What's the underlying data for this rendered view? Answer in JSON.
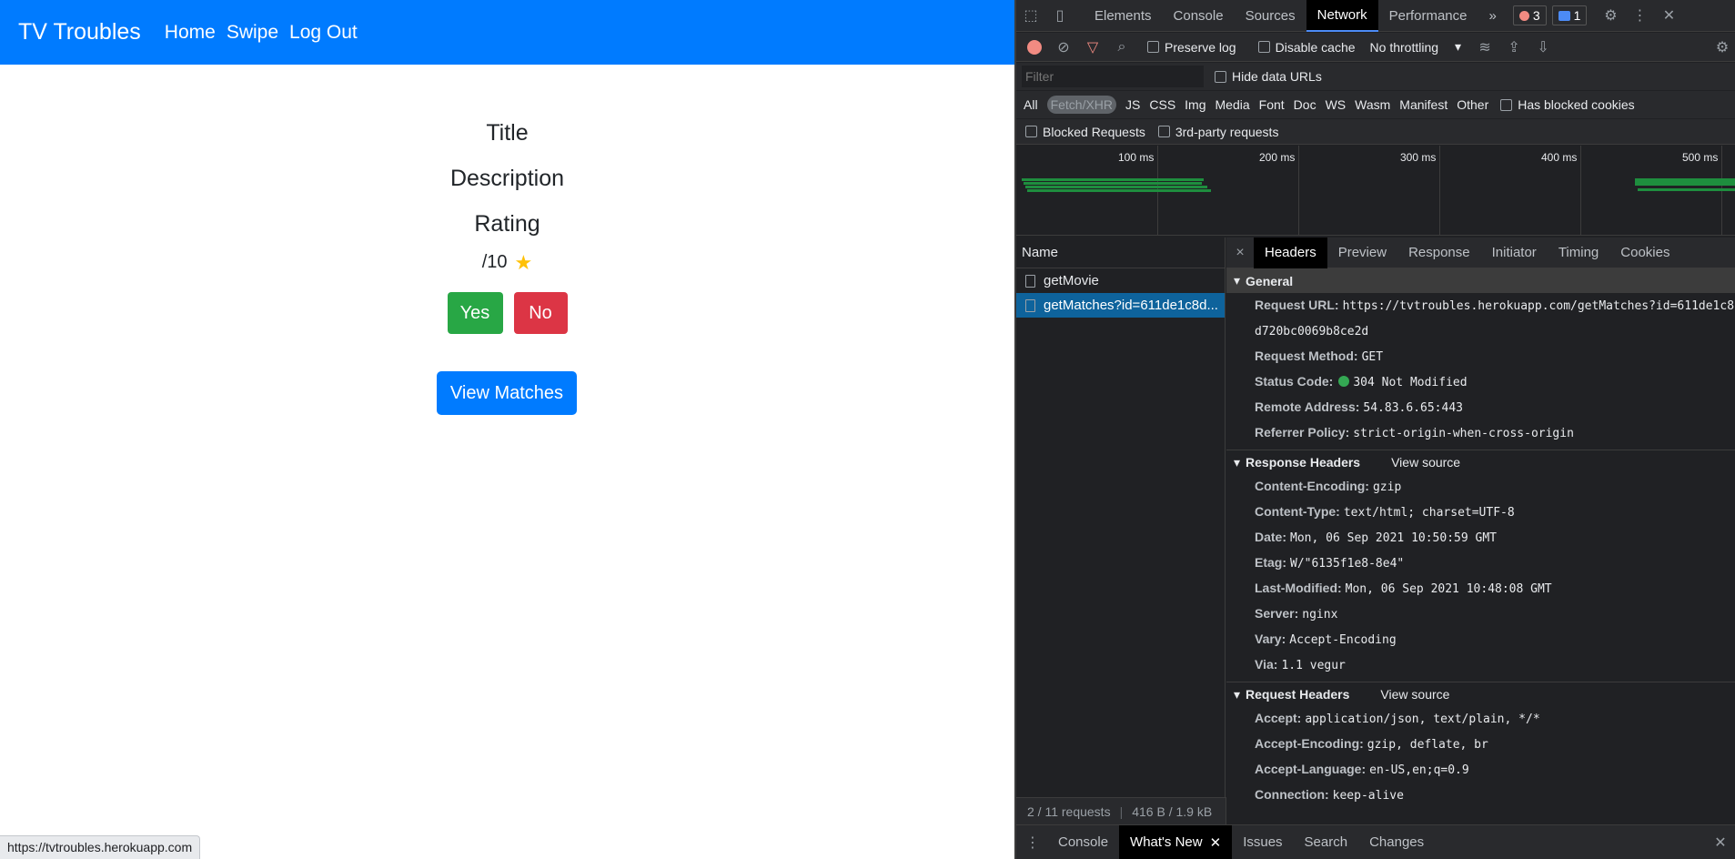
{
  "app": {
    "brand": "TV Troubles",
    "nav": [
      "Home",
      "Swipe",
      "Log Out"
    ],
    "title": "Title",
    "description": "Description",
    "rating_label": "Rating",
    "rating_value": "/10",
    "yes_label": "Yes",
    "no_label": "No",
    "view_matches_label": "View Matches",
    "status_url": "https://tvtroubles.herokuapp.com"
  },
  "devtools": {
    "tabs": [
      "Elements",
      "Console",
      "Sources",
      "Network",
      "Performance"
    ],
    "active_tab": "Network",
    "more": "»",
    "error_count": "3",
    "message_count": "1",
    "toolbar": {
      "preserve_log": "Preserve log",
      "disable_cache": "Disable cache",
      "throttling": "No throttling"
    },
    "filter": {
      "placeholder": "Filter",
      "hide_data_urls": "Hide data URLs"
    },
    "types": [
      "All",
      "Fetch/XHR",
      "JS",
      "CSS",
      "Img",
      "Media",
      "Font",
      "Doc",
      "WS",
      "Wasm",
      "Manifest",
      "Other"
    ],
    "selected_type": "Fetch/XHR",
    "has_blocked_cookies": "Has blocked cookies",
    "blocked_requests": "Blocked Requests",
    "third_party": "3rd-party requests",
    "timeline_ticks": [
      "100 ms",
      "200 ms",
      "300 ms",
      "400 ms",
      "500 ms"
    ],
    "name_header": "Name",
    "requests": [
      "getMovie",
      "getMatches?id=611de1c8d..."
    ],
    "detail_tabs": [
      "Headers",
      "Preview",
      "Response",
      "Initiator",
      "Timing",
      "Cookies"
    ],
    "general": {
      "title": "General",
      "rows": [
        {
          "k": "Request URL:",
          "v": "https://tvtroubles.herokuapp.com/getMatches?id=611de1c8d720bc0069b8ce2d"
        },
        {
          "k": "Request Method:",
          "v": "GET"
        },
        {
          "k": "Status Code:",
          "v": "304 Not Modified"
        },
        {
          "k": "Remote Address:",
          "v": "54.83.6.65:443"
        },
        {
          "k": "Referrer Policy:",
          "v": "strict-origin-when-cross-origin"
        }
      ]
    },
    "response_headers": {
      "title": "Response Headers",
      "view_source": "View source",
      "rows": [
        {
          "k": "Content-Encoding:",
          "v": "gzip"
        },
        {
          "k": "Content-Type:",
          "v": "text/html; charset=UTF-8"
        },
        {
          "k": "Date:",
          "v": "Mon, 06 Sep 2021 10:50:59 GMT"
        },
        {
          "k": "Etag:",
          "v": "W/\"6135f1e8-8e4\""
        },
        {
          "k": "Last-Modified:",
          "v": "Mon, 06 Sep 2021 10:48:08 GMT"
        },
        {
          "k": "Server:",
          "v": "nginx"
        },
        {
          "k": "Vary:",
          "v": "Accept-Encoding"
        },
        {
          "k": "Via:",
          "v": "1.1 vegur"
        }
      ]
    },
    "request_headers": {
      "title": "Request Headers",
      "view_source": "View source",
      "rows": [
        {
          "k": "Accept:",
          "v": "application/json, text/plain, */*"
        },
        {
          "k": "Accept-Encoding:",
          "v": "gzip, deflate, br"
        },
        {
          "k": "Accept-Language:",
          "v": "en-US,en;q=0.9"
        },
        {
          "k": "Connection:",
          "v": "keep-alive"
        }
      ]
    },
    "summary_requests": "2 / 11 requests",
    "summary_size": "416 B / 1.9 kB",
    "drawer_tabs": [
      "Console",
      "What's New",
      "Issues",
      "Search",
      "Changes"
    ],
    "drawer_active": "What's New"
  }
}
